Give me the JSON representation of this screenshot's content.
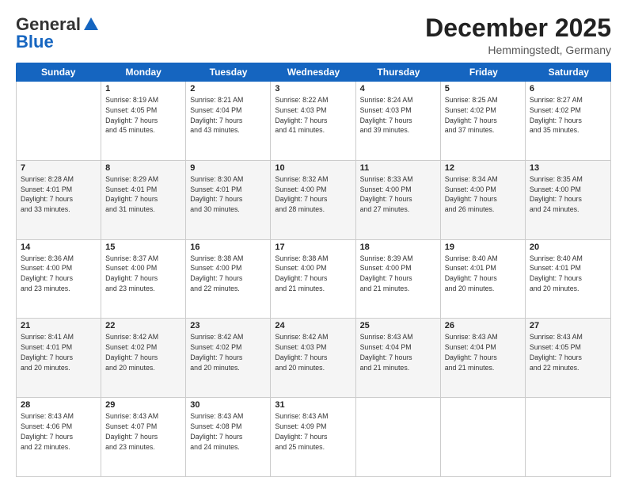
{
  "header": {
    "logo_general": "General",
    "logo_blue": "Blue",
    "month": "December 2025",
    "location": "Hemmingstedt, Germany"
  },
  "weekdays": [
    "Sunday",
    "Monday",
    "Tuesday",
    "Wednesday",
    "Thursday",
    "Friday",
    "Saturday"
  ],
  "rows": [
    [
      {
        "day": "",
        "info": ""
      },
      {
        "day": "1",
        "info": "Sunrise: 8:19 AM\nSunset: 4:05 PM\nDaylight: 7 hours\nand 45 minutes."
      },
      {
        "day": "2",
        "info": "Sunrise: 8:21 AM\nSunset: 4:04 PM\nDaylight: 7 hours\nand 43 minutes."
      },
      {
        "day": "3",
        "info": "Sunrise: 8:22 AM\nSunset: 4:03 PM\nDaylight: 7 hours\nand 41 minutes."
      },
      {
        "day": "4",
        "info": "Sunrise: 8:24 AM\nSunset: 4:03 PM\nDaylight: 7 hours\nand 39 minutes."
      },
      {
        "day": "5",
        "info": "Sunrise: 8:25 AM\nSunset: 4:02 PM\nDaylight: 7 hours\nand 37 minutes."
      },
      {
        "day": "6",
        "info": "Sunrise: 8:27 AM\nSunset: 4:02 PM\nDaylight: 7 hours\nand 35 minutes."
      }
    ],
    [
      {
        "day": "7",
        "info": "Sunrise: 8:28 AM\nSunset: 4:01 PM\nDaylight: 7 hours\nand 33 minutes."
      },
      {
        "day": "8",
        "info": "Sunrise: 8:29 AM\nSunset: 4:01 PM\nDaylight: 7 hours\nand 31 minutes."
      },
      {
        "day": "9",
        "info": "Sunrise: 8:30 AM\nSunset: 4:01 PM\nDaylight: 7 hours\nand 30 minutes."
      },
      {
        "day": "10",
        "info": "Sunrise: 8:32 AM\nSunset: 4:00 PM\nDaylight: 7 hours\nand 28 minutes."
      },
      {
        "day": "11",
        "info": "Sunrise: 8:33 AM\nSunset: 4:00 PM\nDaylight: 7 hours\nand 27 minutes."
      },
      {
        "day": "12",
        "info": "Sunrise: 8:34 AM\nSunset: 4:00 PM\nDaylight: 7 hours\nand 26 minutes."
      },
      {
        "day": "13",
        "info": "Sunrise: 8:35 AM\nSunset: 4:00 PM\nDaylight: 7 hours\nand 24 minutes."
      }
    ],
    [
      {
        "day": "14",
        "info": "Sunrise: 8:36 AM\nSunset: 4:00 PM\nDaylight: 7 hours\nand 23 minutes."
      },
      {
        "day": "15",
        "info": "Sunrise: 8:37 AM\nSunset: 4:00 PM\nDaylight: 7 hours\nand 23 minutes."
      },
      {
        "day": "16",
        "info": "Sunrise: 8:38 AM\nSunset: 4:00 PM\nDaylight: 7 hours\nand 22 minutes."
      },
      {
        "day": "17",
        "info": "Sunrise: 8:38 AM\nSunset: 4:00 PM\nDaylight: 7 hours\nand 21 minutes."
      },
      {
        "day": "18",
        "info": "Sunrise: 8:39 AM\nSunset: 4:00 PM\nDaylight: 7 hours\nand 21 minutes."
      },
      {
        "day": "19",
        "info": "Sunrise: 8:40 AM\nSunset: 4:01 PM\nDaylight: 7 hours\nand 20 minutes."
      },
      {
        "day": "20",
        "info": "Sunrise: 8:40 AM\nSunset: 4:01 PM\nDaylight: 7 hours\nand 20 minutes."
      }
    ],
    [
      {
        "day": "21",
        "info": "Sunrise: 8:41 AM\nSunset: 4:01 PM\nDaylight: 7 hours\nand 20 minutes."
      },
      {
        "day": "22",
        "info": "Sunrise: 8:42 AM\nSunset: 4:02 PM\nDaylight: 7 hours\nand 20 minutes."
      },
      {
        "day": "23",
        "info": "Sunrise: 8:42 AM\nSunset: 4:02 PM\nDaylight: 7 hours\nand 20 minutes."
      },
      {
        "day": "24",
        "info": "Sunrise: 8:42 AM\nSunset: 4:03 PM\nDaylight: 7 hours\nand 20 minutes."
      },
      {
        "day": "25",
        "info": "Sunrise: 8:43 AM\nSunset: 4:04 PM\nDaylight: 7 hours\nand 21 minutes."
      },
      {
        "day": "26",
        "info": "Sunrise: 8:43 AM\nSunset: 4:04 PM\nDaylight: 7 hours\nand 21 minutes."
      },
      {
        "day": "27",
        "info": "Sunrise: 8:43 AM\nSunset: 4:05 PM\nDaylight: 7 hours\nand 22 minutes."
      }
    ],
    [
      {
        "day": "28",
        "info": "Sunrise: 8:43 AM\nSunset: 4:06 PM\nDaylight: 7 hours\nand 22 minutes."
      },
      {
        "day": "29",
        "info": "Sunrise: 8:43 AM\nSunset: 4:07 PM\nDaylight: 7 hours\nand 23 minutes."
      },
      {
        "day": "30",
        "info": "Sunrise: 8:43 AM\nSunset: 4:08 PM\nDaylight: 7 hours\nand 24 minutes."
      },
      {
        "day": "31",
        "info": "Sunrise: 8:43 AM\nSunset: 4:09 PM\nDaylight: 7 hours\nand 25 minutes."
      },
      {
        "day": "",
        "info": ""
      },
      {
        "day": "",
        "info": ""
      },
      {
        "day": "",
        "info": ""
      }
    ]
  ]
}
